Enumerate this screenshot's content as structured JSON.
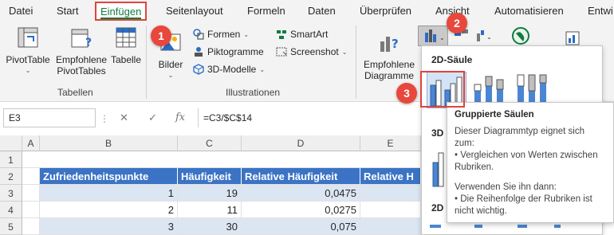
{
  "menu": {
    "tabs": [
      "Datei",
      "Start",
      "Einfügen",
      "Seitenlayout",
      "Formeln",
      "Daten",
      "Überprüfen",
      "Ansicht",
      "Automatisieren",
      "Entwi"
    ]
  },
  "ribbon": {
    "pivot_table": "PivotTable",
    "recommended_pivot_1": "Empfohlene",
    "recommended_pivot_2": "PivotTables",
    "table": "Tabelle",
    "group_tables": "Tabellen",
    "pictures": "Bilder",
    "shapes": "Formen",
    "pictograms": "Piktogramme",
    "models3d": "3D-Modelle",
    "smartart": "SmartArt",
    "screenshot": "Screenshot",
    "group_illustrations": "Illustrationen",
    "recommended_charts_1": "Empfohlene",
    "recommended_charts_2": "Diagramme"
  },
  "formula_bar": {
    "name_box": "E3",
    "fx": "fx",
    "formula": "=C3/$C$14"
  },
  "grid": {
    "columns": [
      "A",
      "B",
      "C",
      "D",
      "E"
    ],
    "rows": [
      "1",
      "2",
      "3",
      "4",
      "5"
    ],
    "headers": [
      "Zufriedenheitspunkte",
      "Häufigkeit",
      "Relative Häufigkeit",
      "Relative H"
    ],
    "data": [
      [
        "1",
        "19",
        "0,0475"
      ],
      [
        "2",
        "11",
        "0,0275"
      ],
      [
        "3",
        "30",
        "0,075"
      ]
    ]
  },
  "gallery": {
    "section_2d": "2D-Säule",
    "section_3d": "3D",
    "section_2d_bar": "2D"
  },
  "tooltip": {
    "title": "Gruppierte Säulen",
    "line1": "Dieser Diagrammtyp eignet sich zum:",
    "line2": "• Vergleichen von Werten zwischen Rubriken.",
    "line3": "Verwenden Sie ihn dann:",
    "line4": "• Die Reihenfolge der Rubriken ist nicht wichtig."
  },
  "steps": [
    "1",
    "2",
    "3"
  ],
  "colors": {
    "accent_green": "#107c41",
    "header_blue": "#3b73c5",
    "band_blue": "#dce6f3",
    "badge_red": "#e8473c"
  }
}
